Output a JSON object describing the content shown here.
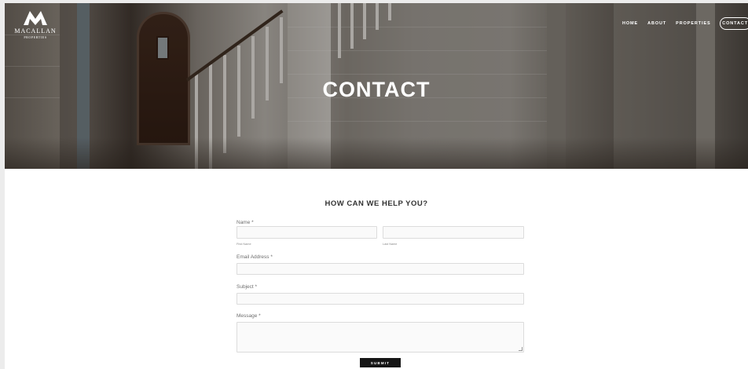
{
  "brand": {
    "name": "MACALLAN",
    "subtitle": "PROPERTIES"
  },
  "nav": {
    "home": "HOME",
    "about": "ABOUT",
    "properties": "PROPERTIES",
    "contact": "CONTACT"
  },
  "hero": {
    "title": "CONTACT"
  },
  "form": {
    "heading": "HOW CAN WE HELP YOU?",
    "name_label": "Name *",
    "first_name_label": "First Name",
    "last_name_label": "Last Name",
    "email_label": "Email Address *",
    "subject_label": "Subject *",
    "message_label": "Message *",
    "submit_label": "SUBMIT",
    "first_name_value": "",
    "last_name_value": "",
    "email_value": "",
    "subject_value": "",
    "message_value": ""
  }
}
